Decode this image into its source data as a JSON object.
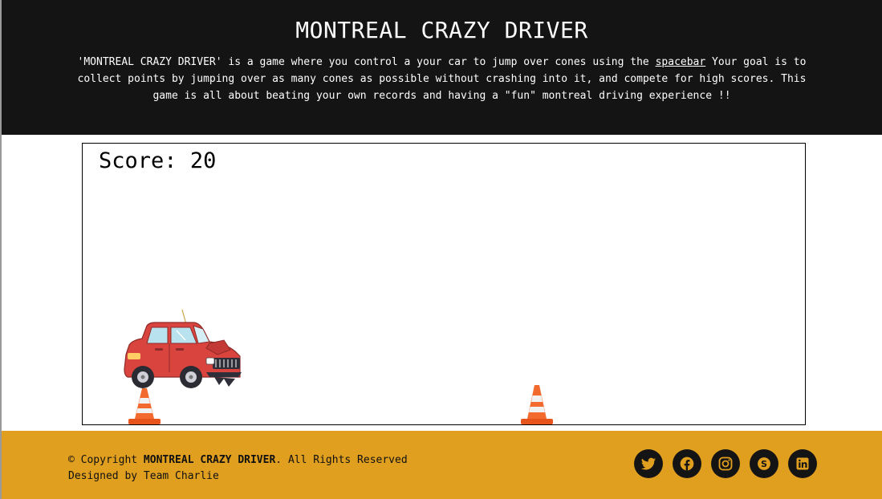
{
  "header": {
    "title": "MONTREAL CRAZY DRIVER",
    "desc_part1": "'MONTREAL CRAZY DRIVER' is a game where you control a your car to jump over cones using the ",
    "desc_key": "spacebar",
    "desc_part2": " Your goal is to collect points by jumping over as many cones as possible without crashing into it, and compete for high scores. This game is all about beating your own records and having a \"fun\" montreal driving experience !!"
  },
  "game": {
    "score_label": "Score:",
    "score_value": "20",
    "player": {
      "sprite": "crashed-red-car"
    },
    "obstacles": [
      {
        "sprite": "traffic-cone"
      },
      {
        "sprite": "traffic-cone"
      }
    ]
  },
  "footer": {
    "copyright_prefix": "© Copyright ",
    "brand": "MONTREAL CRAZY DRIVER",
    "copyright_suffix": ". All Rights Reserved",
    "designed_by": "Designed by Team Charlie",
    "socials": [
      {
        "icon": "twitter-icon"
      },
      {
        "icon": "facebook-icon"
      },
      {
        "icon": "instagram-icon"
      },
      {
        "icon": "skype-icon"
      },
      {
        "icon": "linkedin-icon"
      }
    ]
  },
  "colors": {
    "header_bg": "#141414",
    "footer_bg": "#e09f1f",
    "icon_accent": "#e09f1f",
    "car_red": "#d9443f",
    "cone_orange": "#f26a2e"
  }
}
